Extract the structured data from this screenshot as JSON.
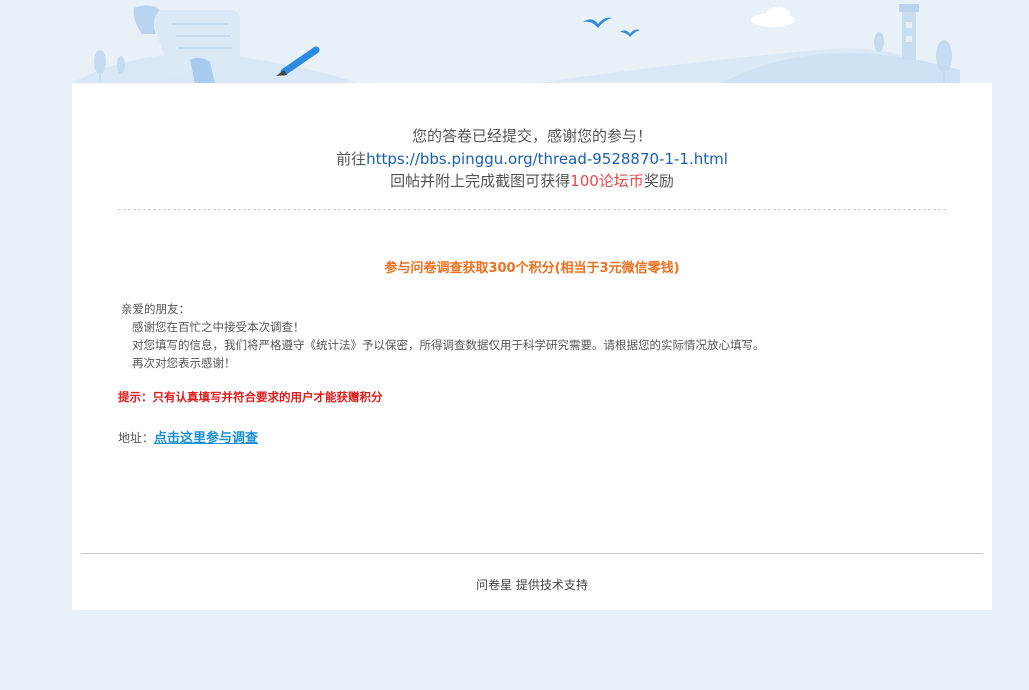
{
  "message": {
    "line1": "您的答卷已经提交，感谢您的参与！",
    "line2_prefix": "前往",
    "line2_link": "https://bbs.pinggu.org/thread-9528870-1-1.html",
    "line3_prefix": "回帖并附上完成截图可获得",
    "line3_highlight": "100论坛币",
    "line3_suffix": "奖励"
  },
  "survey": {
    "title": "参与问卷调查获取300个积分(相当于3元微信零钱)",
    "greeting": "亲爱的朋友：",
    "para1": "感谢您在百忙之中接受本次调查！",
    "para2": "对您填写的信息，我们将严格遵守《统计法》予以保密，所得调查数据仅用于科学研究需要。请根据您的实际情况放心填写。",
    "para3": "再次对您表示感谢！",
    "tip": "提示：只有认真填写并符合要求的用户才能获赠积分",
    "address_label": "地址：",
    "address_link": "点击这里参与调查"
  },
  "footer": {
    "text": "问卷星 提供技术支持"
  }
}
